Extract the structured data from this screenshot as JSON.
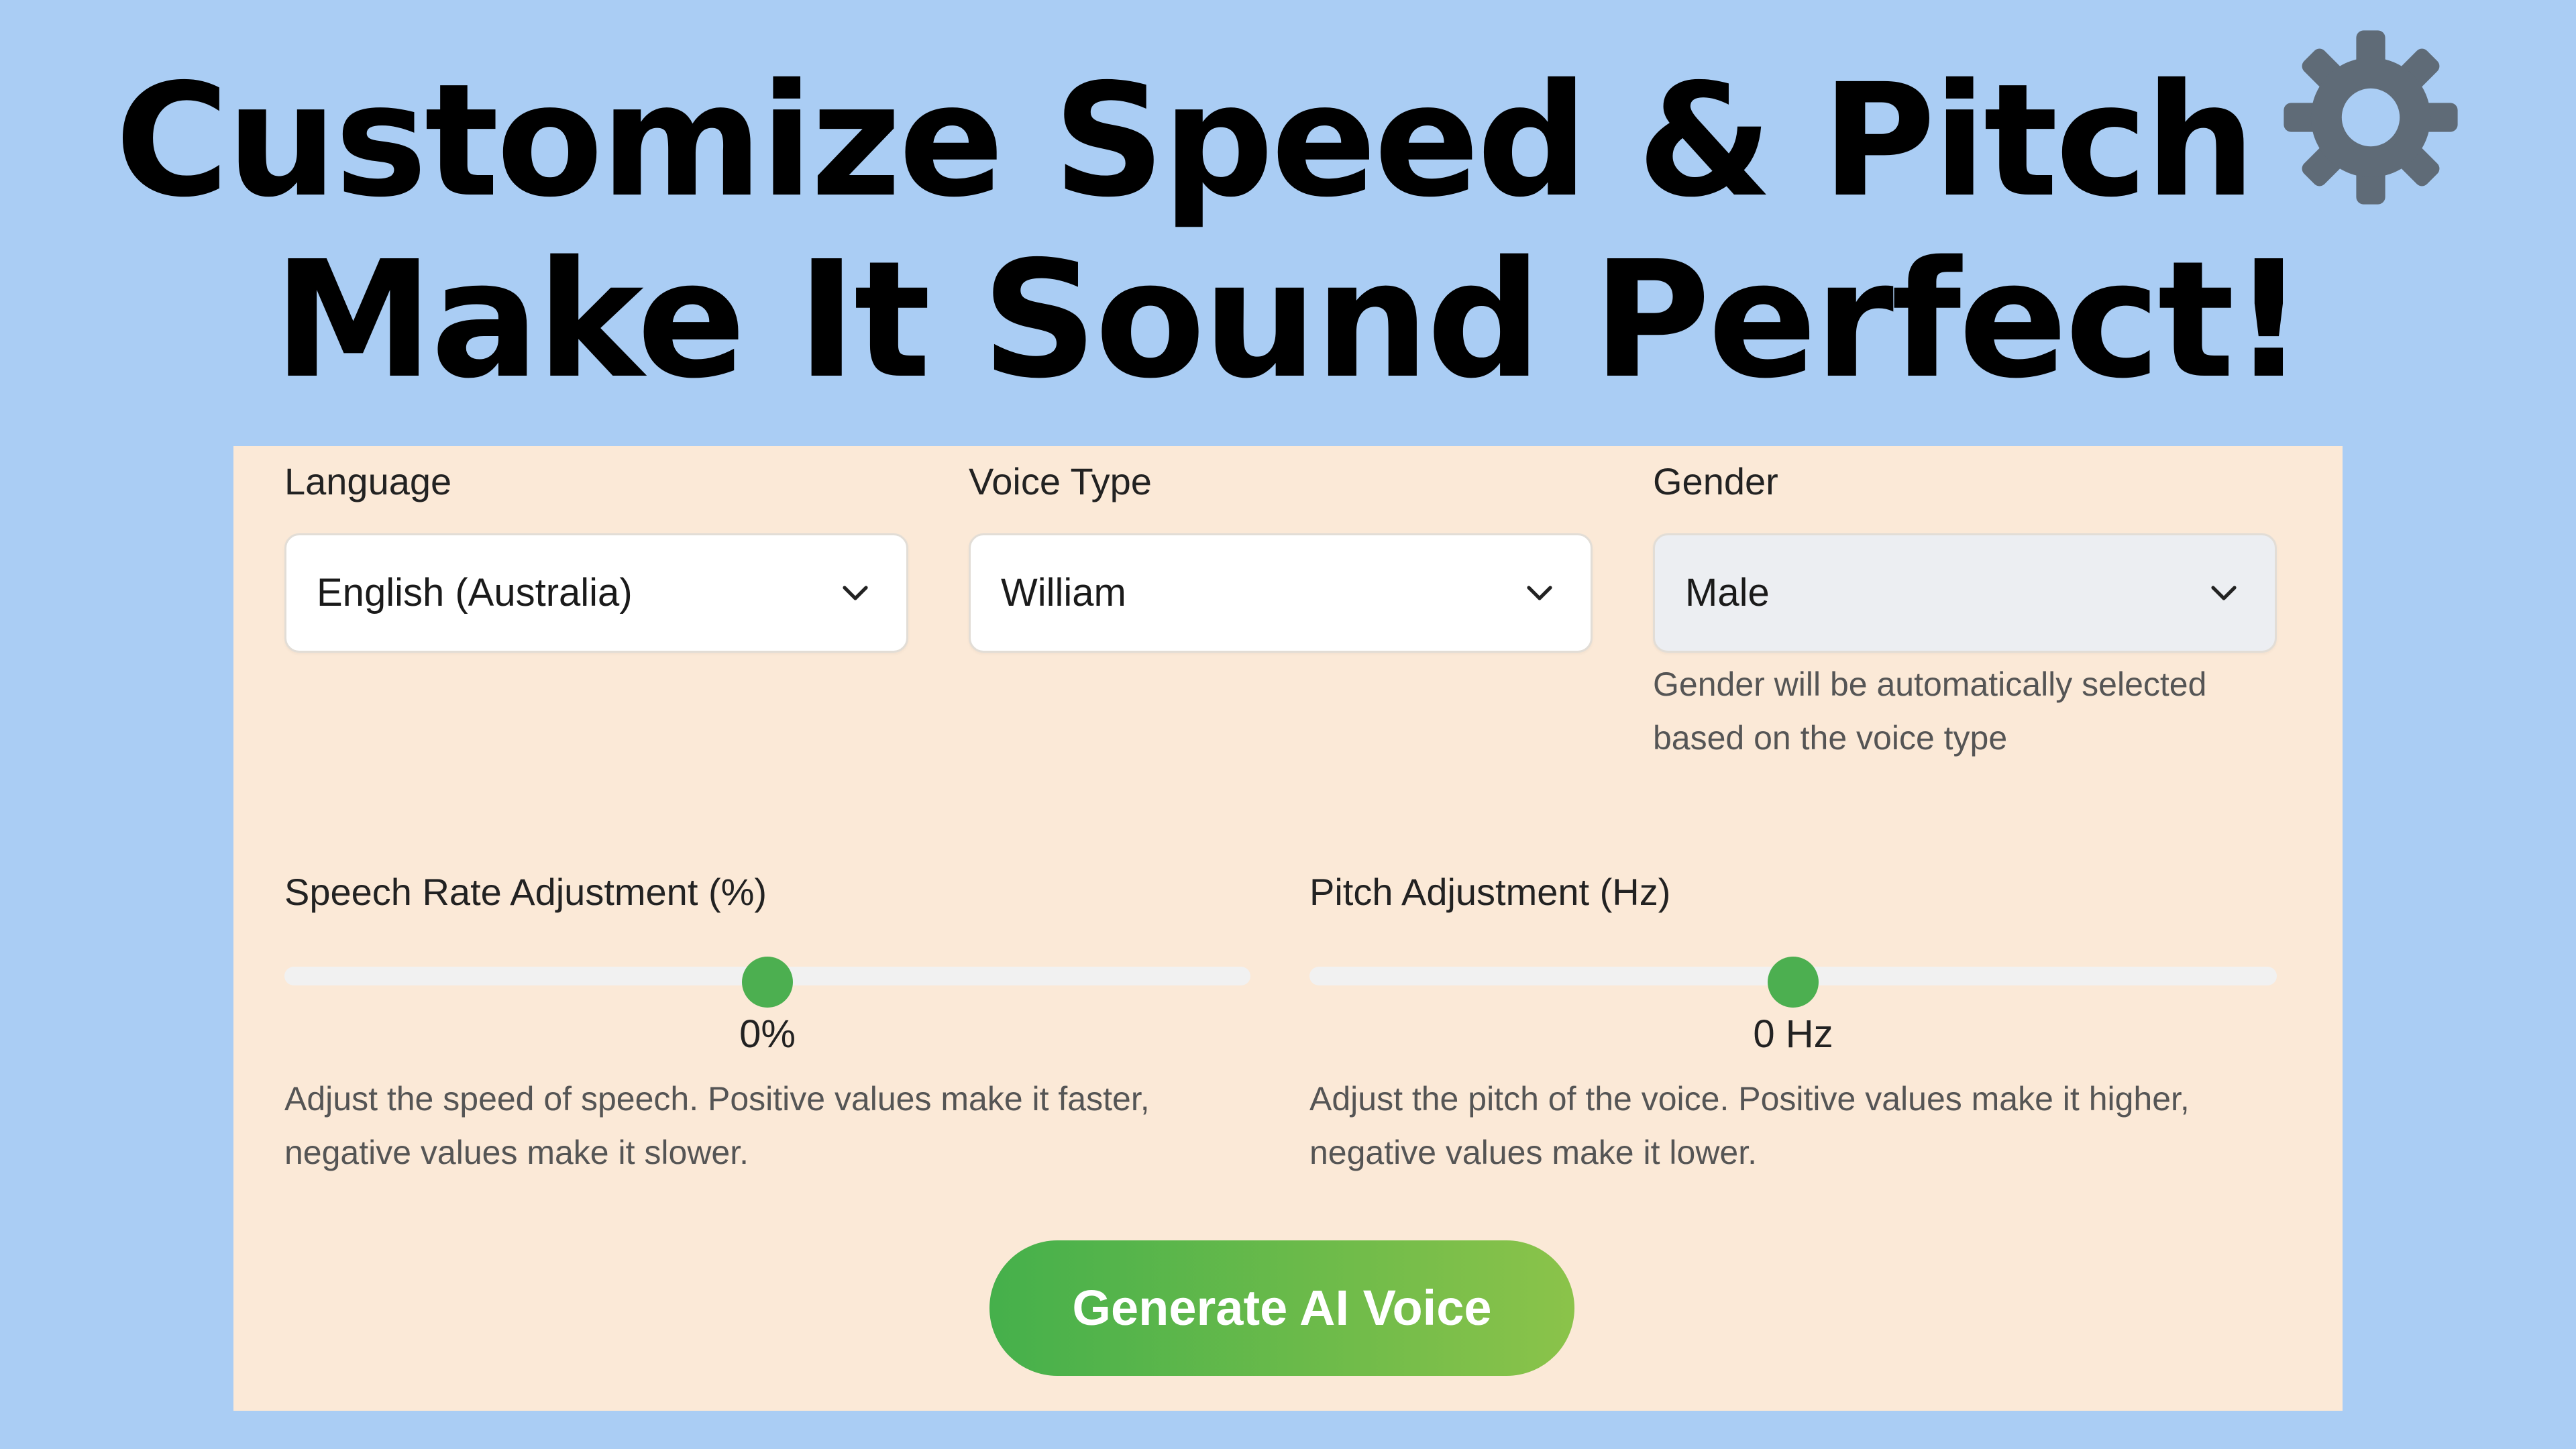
{
  "header": {
    "line1": "Customize Speed & Pitch",
    "line2": "Make It Sound Perfect!",
    "icon": "gear-icon"
  },
  "form": {
    "language": {
      "label": "Language",
      "value": "English (Australia)"
    },
    "voice_type": {
      "label": "Voice Type",
      "value": "William"
    },
    "gender": {
      "label": "Gender",
      "value": "Male",
      "hint": "Gender will be automatically selected based on the voice type"
    },
    "speech_rate": {
      "label": "Speech Rate Adjustment (%)",
      "value_text": "0%",
      "position_fraction": 0.5,
      "hint": "Adjust the speed of speech. Positive values make it faster, negative values make it slower."
    },
    "pitch": {
      "label": "Pitch Adjustment (Hz)",
      "value_text": "0 Hz",
      "position_fraction": 0.5,
      "hint": "Adjust the pitch of the voice. Positive values make it higher, negative values make it lower."
    },
    "generate_label": "Generate AI Voice"
  },
  "colors": {
    "background": "#aacdf4",
    "panel": "#fbe9d7",
    "accent": "#4caf50",
    "gear": "#5f6b77"
  }
}
